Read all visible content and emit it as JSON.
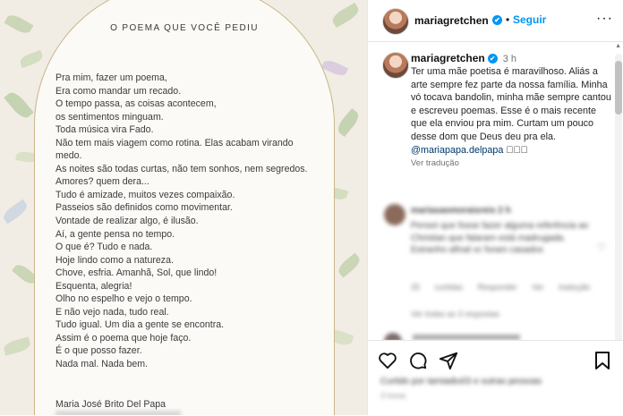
{
  "post_image": {
    "title": "O POEMA QUE VOCÊ PEDIU",
    "lines": [
      "Pra mim, fazer um poema,",
      "Era como mandar um recado.",
      "O tempo passa, as coisas acontecem,",
      "os sentimentos minguam.",
      "Toda música vira Fado.",
      "Não tem mais viagem como rotina. Elas acabam virando",
      "medo.",
      "As noites são todas curtas, não tem sonhos, nem segredos.",
      "Amores? quem dera...",
      "Tudo é amizade, muitos vezes compaixão.",
      "Passeios são definidos como movimentar.",
      "Vontade de realizar algo, é ilusão.",
      "Aí, a gente pensa no tempo.",
      "O que é? Tudo e nada.",
      "Hoje lindo como a natureza.",
      "Chove, esfria. Amanhã, Sol, que lindo!",
      "Esquenta, alegria!",
      "Olho no espelho e vejo o tempo.",
      "E não vejo nada, tudo real.",
      "Tudo igual. Um dia a gente se encontra.",
      "Assim é o poema que hoje faço.",
      "É o que posso fazer.",
      "Nada mal. Nada bem."
    ],
    "author": "Maria José Brito Del Papa"
  },
  "header": {
    "username": "mariagretchen",
    "verified_mark": "✔",
    "separator": "•",
    "follow_label": "Seguir",
    "more_icon": "···"
  },
  "caption": {
    "username": "mariagretchen",
    "verified_mark": "✔",
    "time": "3 h",
    "text": "Ter uma mãe poetisa é maravilhoso. Aliás a arte sempre fez parte da nossa família. Minha vó tocava bandolin, minha mãe sempre cantou e escreveu poemas. Esse é o mais recente que ela enviou pra mim. Curtam um pouco desse dom que Deus deu pra ela.",
    "mention": "@mariapapa.delpapa",
    "emojis": "\u0000\u0000\u0000",
    "translate_label": "Ver tradução"
  },
  "comment": {
    "username": "mariasaomoraisreis 2 h",
    "text": "Pensei que fosse fazer alguma referência ao Christian que falaram está madrugada. Estranho afinal vc foram casados",
    "meta": "25 curtidas Responder Ver tradução",
    "replies": "Ver todas as 3 respostas"
  },
  "actions": {
    "likes_text": "Curtido por tamiadiu03 e outras pessoas",
    "time_ago": "3 horas"
  },
  "colors": {
    "accent": "#0095f6",
    "mention": "#00376b"
  }
}
